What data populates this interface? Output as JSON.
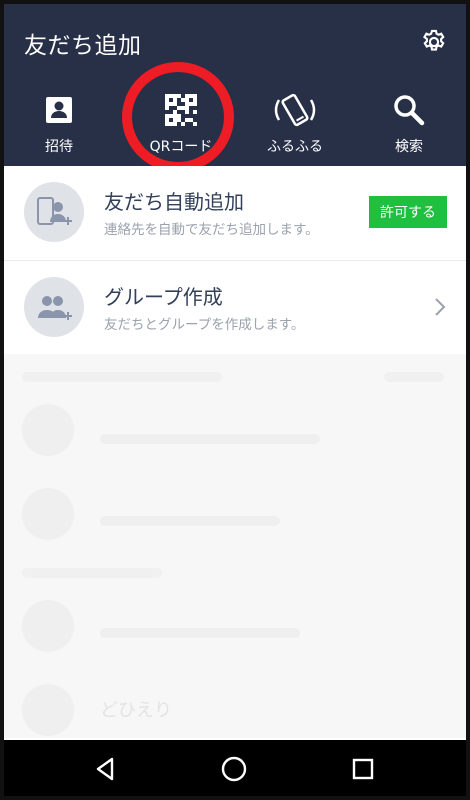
{
  "header": {
    "title": "友だち追加",
    "background": "#283048"
  },
  "tabs": [
    {
      "label": "招待",
      "icon": "contact-card-icon"
    },
    {
      "label": "QRコード",
      "icon": "qr-code-icon"
    },
    {
      "label": "ふるふる",
      "icon": "shake-phone-icon"
    },
    {
      "label": "検索",
      "icon": "search-icon"
    }
  ],
  "highlight_color": "#ee1c24",
  "rows": [
    {
      "title": "友だち自動追加",
      "subtitle": "連絡先を自動で友だち追加します。",
      "action": "許可する",
      "icon": "phone-add-friend-icon"
    },
    {
      "title": "グループ作成",
      "subtitle": "友だちとグループを作成します。",
      "icon": "group-add-icon"
    }
  ],
  "faded": {
    "name_4": "どひえり"
  },
  "accent_green": "#1fbf3f"
}
